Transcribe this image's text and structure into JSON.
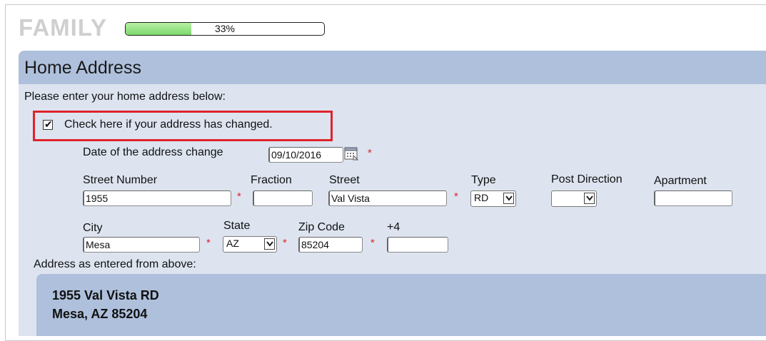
{
  "section": {
    "title": "FAMILY",
    "progress_percent": 33,
    "progress_label": "33%"
  },
  "panel": {
    "title": "Home Address",
    "instructions": "Please enter your home address below:"
  },
  "address_changed": {
    "checked": true,
    "label": "Check here if your address has changed."
  },
  "date_change": {
    "label": "Date of the address change",
    "value": "09/10/2016"
  },
  "fields": {
    "street_number": {
      "label": "Street Number",
      "value": "1955"
    },
    "fraction": {
      "label": "Fraction",
      "value": ""
    },
    "street": {
      "label": "Street",
      "value": "Val Vista"
    },
    "type": {
      "label": "Type",
      "value": "RD"
    },
    "post_direction": {
      "label": "Post Direction",
      "value": ""
    },
    "apartment": {
      "label": "Apartment",
      "value": ""
    },
    "city": {
      "label": "City",
      "value": "Mesa"
    },
    "state": {
      "label": "State",
      "value": "AZ"
    },
    "zip": {
      "label": "Zip Code",
      "value": "85204"
    },
    "plus4": {
      "label": "+4",
      "value": ""
    }
  },
  "required_marker": "*",
  "summary": {
    "label": "Address as entered from above:",
    "line1": "1955 Val Vista RD",
    "line2": "Mesa, AZ 85204"
  },
  "colors": {
    "panel_bg": "#dde4f0",
    "panel_header": "#aec0dc",
    "highlight": "#e0232b",
    "progress_fill": "#7ad86a",
    "required": "#e0232b"
  },
  "icons": {
    "calendar": "calendar-icon",
    "dropdown": "chevron-down-icon",
    "checkbox": "checkmark-icon"
  }
}
